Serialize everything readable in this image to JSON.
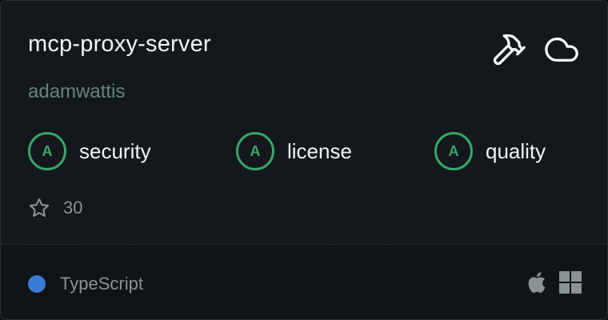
{
  "repo": {
    "name": "mcp-proxy-server",
    "author": "adamwattis"
  },
  "header_icons": [
    "hammer-icon",
    "cloud-icon"
  ],
  "metrics": [
    {
      "grade": "A",
      "label": "security"
    },
    {
      "grade": "A",
      "label": "license"
    },
    {
      "grade": "A",
      "label": "quality"
    }
  ],
  "stars": {
    "icon": "star-icon",
    "count": "30"
  },
  "footer": {
    "language": "TypeScript",
    "language_color": "#3a7bd5",
    "platforms": [
      "apple-icon",
      "windows-icon"
    ]
  },
  "colors": {
    "grade_accent": "#3aa66b",
    "background": "#12181b"
  }
}
